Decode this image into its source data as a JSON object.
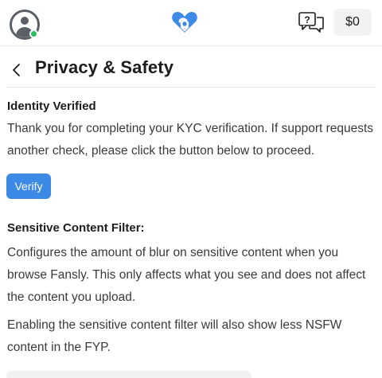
{
  "topbar": {
    "wallet_balance": "$0",
    "icons": {
      "avatar": "user-avatar-icon",
      "logo": "fansly-heart-logo-icon",
      "messages": "messages-help-icon"
    },
    "colors": {
      "brand": "#3d8ae6",
      "online": "#2fbf62"
    }
  },
  "header": {
    "title": "Privacy & Safety",
    "back_icon": "chevron-left-icon"
  },
  "identity": {
    "heading": "Identity Verified",
    "body": "Thank you for completing your KYC verification. If support requests another check, please click the button below to proceed.",
    "verify_label": "Verify"
  },
  "sensitive": {
    "heading": "Sensitive Content Filter:",
    "body1": "Configures the amount of blur on sensitive content when you browse Fansly. This only affects what you see and does not affect the content you upload.",
    "body2": "Enabling the sensitive content filter will also show less NSFW content in the FYP."
  }
}
